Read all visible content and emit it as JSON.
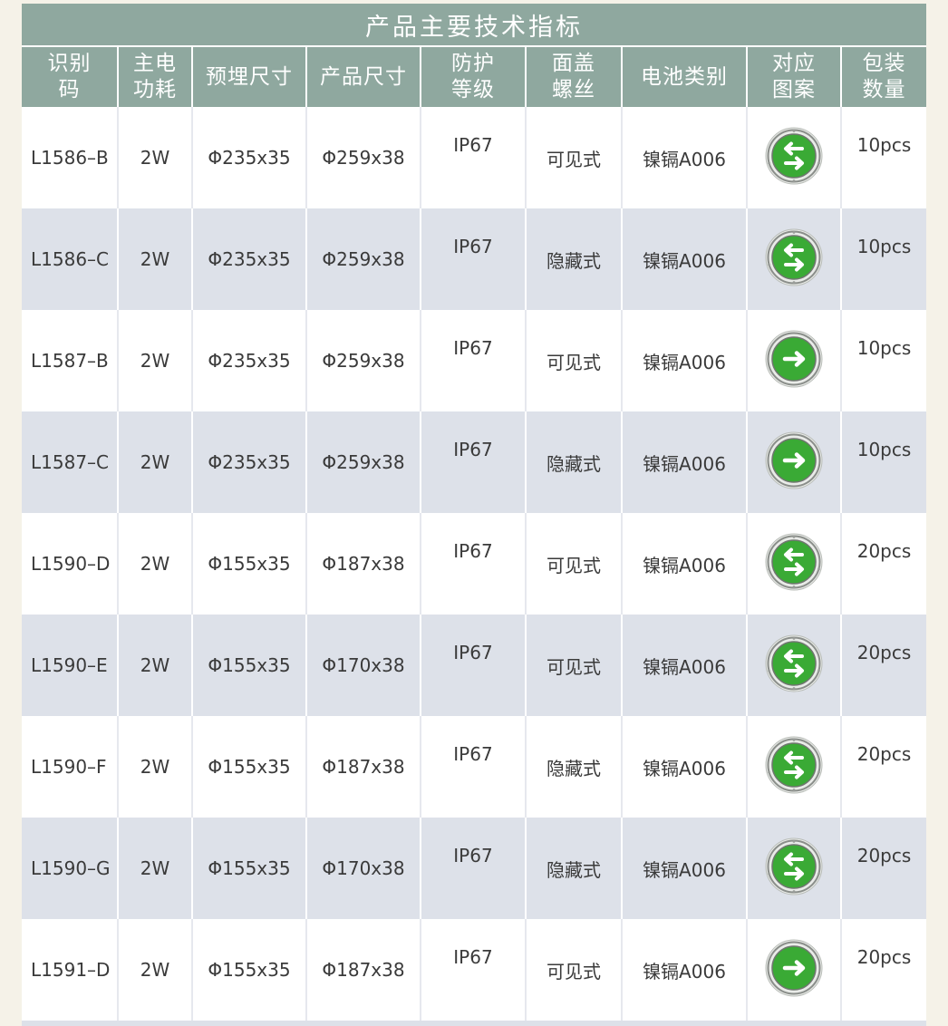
{
  "title": "产品主要技术指标",
  "columns": [
    "识别码",
    "主电功耗",
    "预埋尺寸",
    "产品尺寸",
    "防护等级",
    "面盖螺丝",
    "电池类别",
    "对应图案",
    "包装数量"
  ],
  "rows": [
    {
      "code": "L1586–B",
      "power": "2W",
      "embed": "Φ235x35",
      "size": "Φ259x38",
      "ip": "IP67",
      "screw": "可见式",
      "battery": "镍镉A006",
      "pattern": "double-arrow-icon",
      "pack": "10pcs"
    },
    {
      "code": "L1586–C",
      "power": "2W",
      "embed": "Φ235x35",
      "size": "Φ259x38",
      "ip": "IP67",
      "screw": "隐藏式",
      "battery": "镍镉A006",
      "pattern": "double-arrow-icon",
      "pack": "10pcs"
    },
    {
      "code": "L1587–B",
      "power": "2W",
      "embed": "Φ235x35",
      "size": "Φ259x38",
      "ip": "IP67",
      "screw": "可见式",
      "battery": "镍镉A006",
      "pattern": "right-arrow-icon",
      "pack": "10pcs"
    },
    {
      "code": "L1587–C",
      "power": "2W",
      "embed": "Φ235x35",
      "size": "Φ259x38",
      "ip": "IP67",
      "screw": "隐藏式",
      "battery": "镍镉A006",
      "pattern": "right-arrow-icon",
      "pack": "10pcs"
    },
    {
      "code": "L1590–D",
      "power": "2W",
      "embed": "Φ155x35",
      "size": "Φ187x38",
      "ip": "IP67",
      "screw": "可见式",
      "battery": "镍镉A006",
      "pattern": "double-arrow-icon",
      "pack": "20pcs"
    },
    {
      "code": "L1590–E",
      "power": "2W",
      "embed": "Φ155x35",
      "size": "Φ170x38",
      "ip": "IP67",
      "screw": "可见式",
      "battery": "镍镉A006",
      "pattern": "double-arrow-icon",
      "pack": "20pcs"
    },
    {
      "code": "L1590–F",
      "power": "2W",
      "embed": "Φ155x35",
      "size": "Φ187x38",
      "ip": "IP67",
      "screw": "隐藏式",
      "battery": "镍镉A006",
      "pattern": "double-arrow-icon",
      "pack": "20pcs"
    },
    {
      "code": "L1590–G",
      "power": "2W",
      "embed": "Φ155x35",
      "size": "Φ170x38",
      "ip": "IP67",
      "screw": "隐藏式",
      "battery": "镍镉A006",
      "pattern": "double-arrow-icon",
      "pack": "20pcs"
    },
    {
      "code": "L1591–D",
      "power": "2W",
      "embed": "Φ155x35",
      "size": "Φ187x38",
      "ip": "IP67",
      "screw": "可见式",
      "battery": "镍镉A006",
      "pattern": "right-arrow-icon",
      "pack": "20pcs"
    }
  ],
  "colors": {
    "header": "#8fa89f",
    "stripe": "#dde1e9",
    "sign_green": "#3aaa35"
  }
}
